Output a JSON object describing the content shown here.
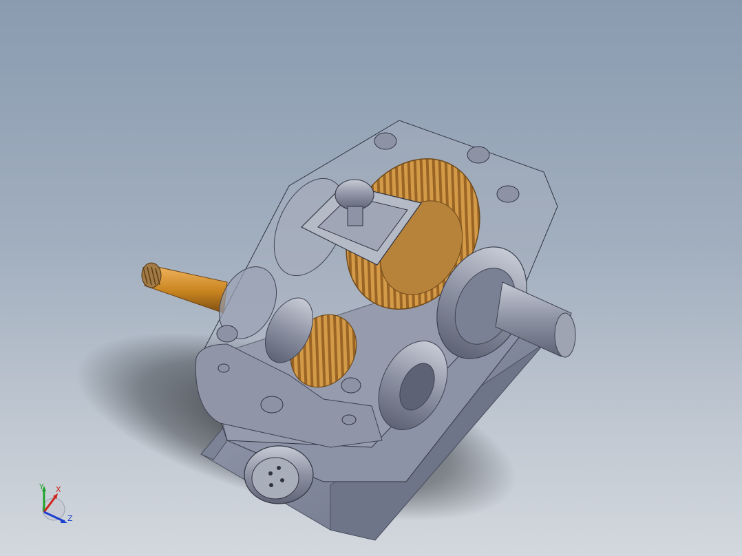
{
  "viewport": {
    "background_top": "#8a9bb0",
    "background_bottom": "#d3d8de"
  },
  "model": {
    "icon": "gear-reducer-assembly",
    "housing_color": "#8e95a8",
    "gear_color": "#d19a45",
    "shaft_color": "#d9952e"
  },
  "triad": {
    "y_label": "Y",
    "x_label": "X",
    "z_label": "Z",
    "y_color": "#1fa32a",
    "x_color": "#d0241b",
    "z_color": "#1d3fd0"
  }
}
